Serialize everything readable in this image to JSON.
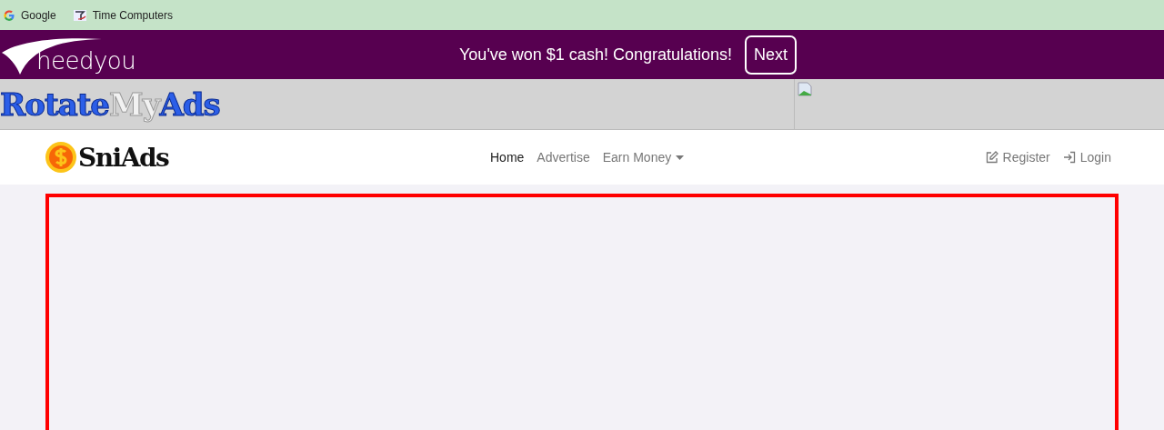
{
  "bookmarks": [
    {
      "kind": "google",
      "label": "Google"
    },
    {
      "kind": "site",
      "label": "Time Computers"
    }
  ],
  "promo_bar": {
    "logo": "heedyou",
    "message": "You've won $1 cash! Congratulations!",
    "button": "Next"
  },
  "ad_banner": {
    "logo_parts": [
      "Rotate",
      "My",
      "Ads"
    ]
  },
  "navbar": {
    "brand": "SniAds",
    "links": [
      {
        "label": "Home",
        "selected": true,
        "dropdown": false
      },
      {
        "label": "Advertise",
        "selected": false,
        "dropdown": false
      },
      {
        "label": "Earn Money",
        "selected": false,
        "dropdown": true
      }
    ],
    "account": [
      {
        "kind": "register",
        "label": "Register"
      },
      {
        "kind": "login",
        "label": "Login"
      }
    ]
  }
}
